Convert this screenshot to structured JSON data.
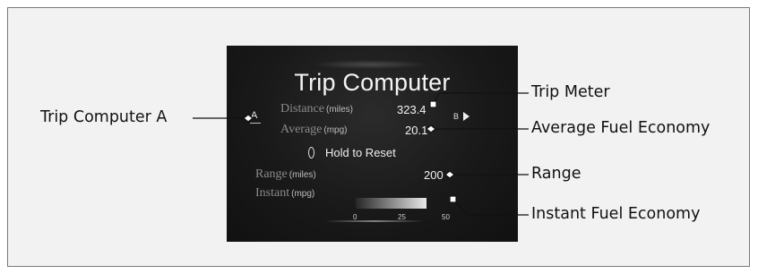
{
  "screen": {
    "title": "Trip Computer",
    "distance_label": "Distance",
    "distance_unit": "(miles)",
    "distance_value": "323.4",
    "average_label": "Average",
    "average_unit": "(mpg)",
    "average_value": "20.1",
    "mode_a": "A",
    "mode_b": "B",
    "hold_to_reset": "Hold to Reset",
    "range_label": "Range",
    "range_unit": "(miles)",
    "range_value": "200",
    "instant_label": "Instant",
    "instant_unit": "(mpg)",
    "instant_fraction": 0.72,
    "ticks": [
      "0",
      "25",
      "50"
    ]
  },
  "callouts": {
    "trip_computer_a": "Trip Computer A",
    "trip_meter": "Trip Meter",
    "average_fuel_economy": "Average Fuel Economy",
    "range": "Range",
    "instant_fuel_economy": "Instant Fuel Economy"
  },
  "colors": {
    "frame_bg": "#f2f2f2",
    "screen_bg": "#191919",
    "leader_line": "#111111"
  }
}
